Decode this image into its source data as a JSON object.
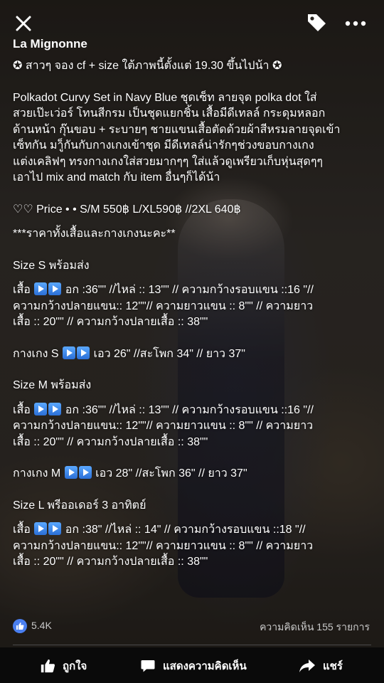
{
  "header": {
    "page_name": "La Mignonne",
    "icons": [
      "close-icon",
      "tag-icon",
      "more-icon"
    ]
  },
  "post": {
    "line1": "✪ สาวๆ จอง cf + size ใต้ภาพนี้ตั้งแต่ 19.30 ขึ้นไปน้า ✪",
    "desc": [
      "Polkadot Curvy Set in Navy Blue ชุดเซ็ท ลายจุด polka dot ใส่",
      "สวยเป๊ะเว่อร์ โทนสีกรม เป็นชุดแยกชิ้น เสื้อมีดีเทลล์ กระดุมหลอก",
      "ด้านหน้า กุ๊นขอบ + ระบายๆ ชายแขนเสื้อตัดด้วยผ้าสีหรมลายจุดเข้า",
      "เซ็ทกัน มาู็กันกับกางเกงเข้าชุด มีดีเทลล์น่ารักๆช่วงขอบกางเกง",
      "แต่งเคลิฟๆ ทรงกางเกงใส่สวยมากๆๆ ใส่แล้วดูเพรียวเก็บหุ่นสุดๆๆ",
      "เอาไป mix and match กับ item อื่นๆก็ได้น้า"
    ],
    "price": "♡♡ Price • • S/M 550฿  L/XL590฿ //2XL 640฿",
    "price_note": "***ราคาทั้งเสื้อและกางเกงนะคะ**",
    "size_s": {
      "title": "Size S พร้อมส่ง",
      "top_label": "เสื้อ",
      "top_line1": "อก :36\"\" //ไหล่ :: 13\"\" // ความกว้างรอบแขน ::16 \"//",
      "top_line2": "ความกว้างปลายแขน:: 12\"\"// ความยาวแขน :: 8\"\" // ความยาว",
      "top_line3": "เสื้อ :: 20\"\" // ความกว้างปลายเสื้อ :: 38\"\"",
      "pants_label": "กางเกง S",
      "pants_line": "เอว 26\" //สะโพก 34\" // ยาว 37\""
    },
    "size_m": {
      "title": "Size M พร้อมส่ง",
      "top_label": "เสื้อ",
      "top_line1": "อก :36\"\" //ไหล่ :: 13\"\" // ความกว้างรอบแขน ::16 \"//",
      "top_line2": "ความกว้างปลายแขน:: 12\"\"// ความยาวแขน :: 8\"\" // ความยาว",
      "top_line3": "เสื้อ :: 20\"\" // ความกว้างปลายเสื้อ :: 38\"\"",
      "pants_label": "กางเกง M",
      "pants_line": "เอว 28\" //สะโพก 36\" // ยาว 37\""
    },
    "size_l": {
      "title": "Size L พรีออเดอร์ 3 อาทิตย์",
      "top_label": "เสื้อ",
      "top_line1": "อก :38\" //ไหล่ :: 14\" // ความกว้างรอบแขน ::18 \"//",
      "top_line2": "ความกว้างปลายแขน:: 12\"\"// ความยาวแขน :: 8\"\" // ความยาว",
      "top_line3": "เสื้อ :: 20\"\" // ความกว้างปลายเสื้อ :: 38\"\""
    }
  },
  "stats": {
    "likes": "5.4K",
    "comments": "ความคิดเห็น 155 รายการ"
  },
  "actions": {
    "like": "ถูกใจ",
    "comment": "แสดงความคิดเห็น",
    "share": "แชร์"
  },
  "colors": {
    "like_badge": "#4a7ff0",
    "arrow_button": "#3a86f0"
  }
}
